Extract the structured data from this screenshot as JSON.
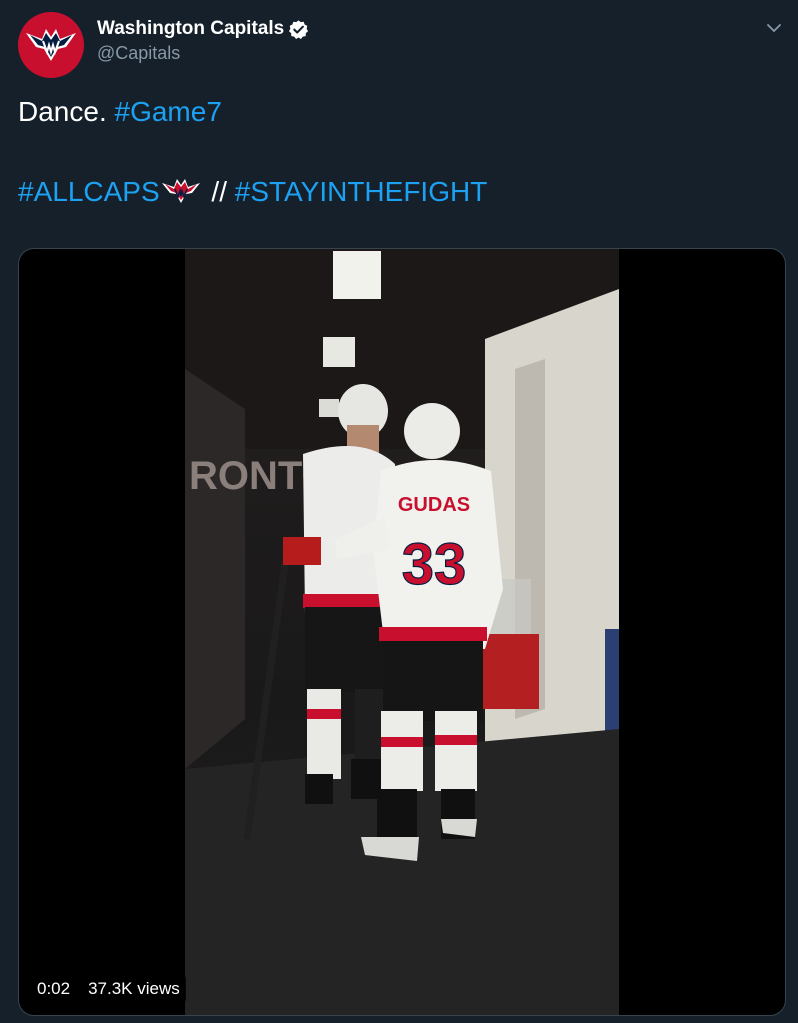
{
  "author": {
    "display_name": "Washington Capitals",
    "handle": "@Capitals",
    "verified": true,
    "avatar_icon": "capitals-eagle-logo"
  },
  "tweet": {
    "line1_text": "Dance. ",
    "line1_hashtag": "#Game7",
    "line2_hashtag1": "#ALLCAPS",
    "line2_separator": " // ",
    "line2_hashtag2": "#STAYINTHEFIGHT"
  },
  "media": {
    "type": "video",
    "time": "0:02",
    "views": "37.3K views",
    "jersey_name": "GUDAS",
    "jersey_number": "33"
  },
  "colors": {
    "background": "#15202b",
    "link": "#1da1f2",
    "secondary_text": "#8899a6",
    "avatar_red": "#c8102e"
  },
  "icons": {
    "menu": "chevron-down-icon",
    "verified": "verified-badge-icon"
  }
}
